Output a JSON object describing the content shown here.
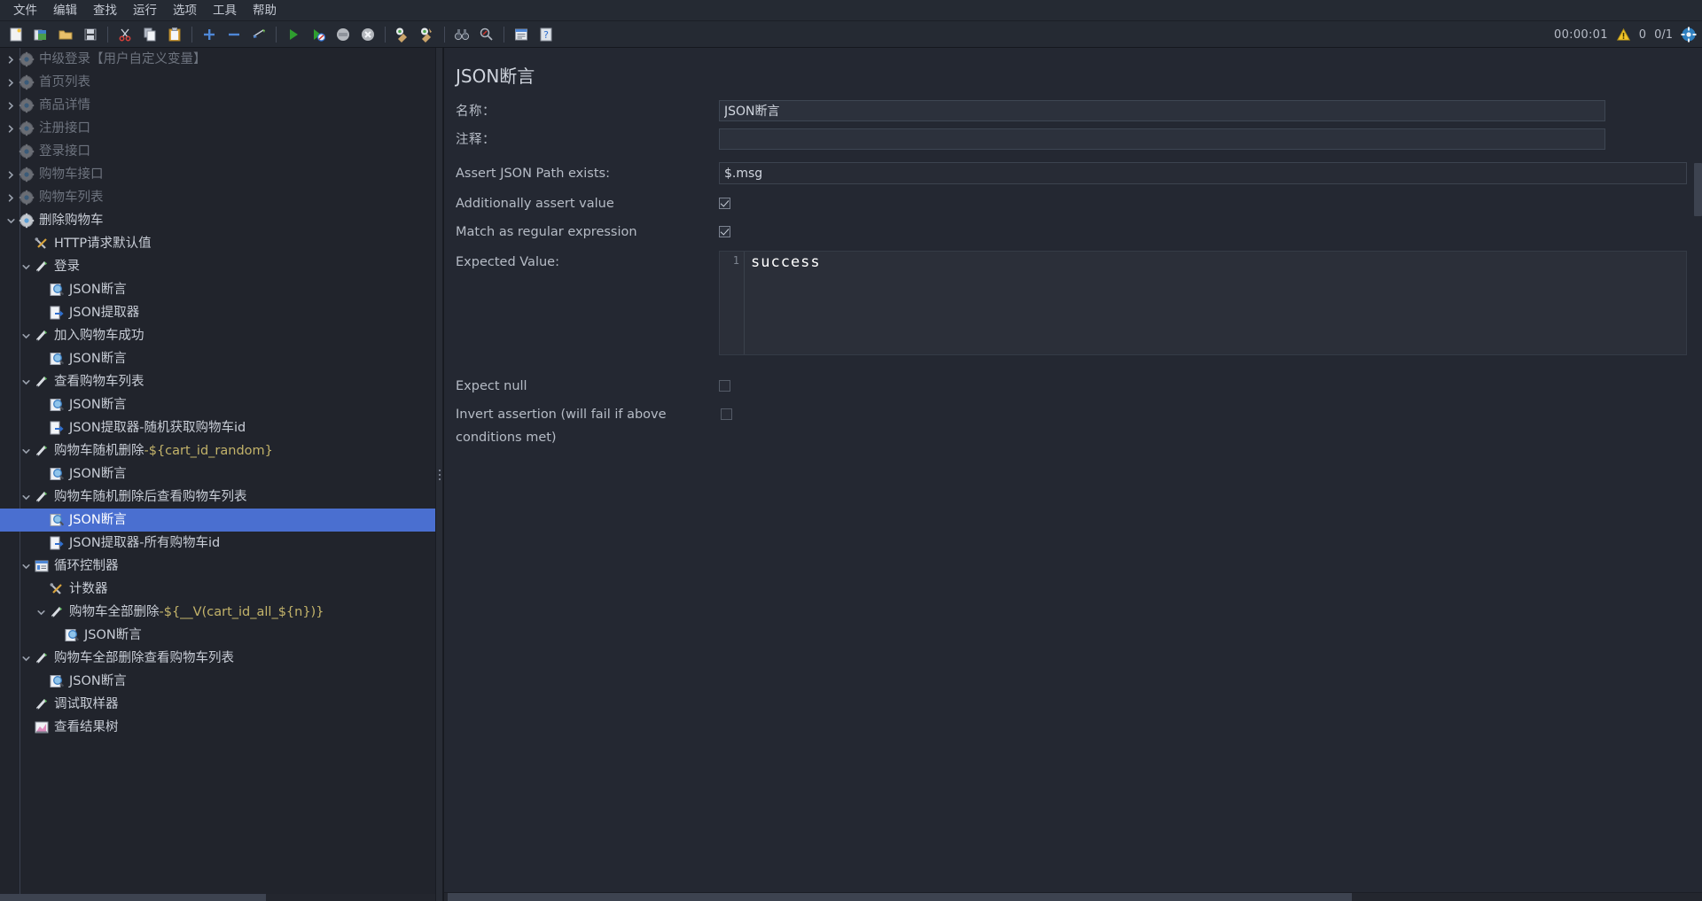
{
  "menubar": {
    "items": [
      {
        "label": "文件",
        "name": "menu-file"
      },
      {
        "label": "编辑",
        "name": "menu-edit"
      },
      {
        "label": "查找",
        "name": "menu-search"
      },
      {
        "label": "运行",
        "name": "menu-run"
      },
      {
        "label": "选项",
        "name": "menu-options"
      },
      {
        "label": "工具",
        "name": "menu-tools"
      },
      {
        "label": "帮助",
        "name": "menu-help"
      }
    ]
  },
  "toolbar": {
    "buttons": [
      {
        "icon": "new-file-icon",
        "name": "new-button"
      },
      {
        "icon": "templates-icon",
        "name": "templates-button"
      },
      {
        "icon": "open-folder-icon",
        "name": "open-button"
      },
      {
        "icon": "save-icon",
        "name": "save-button"
      },
      {
        "sep": true
      },
      {
        "icon": "cut-scissors-icon",
        "name": "cut-button"
      },
      {
        "icon": "copy-icon",
        "name": "copy-button"
      },
      {
        "icon": "paste-clipboard-icon",
        "name": "paste-button"
      },
      {
        "sep": true
      },
      {
        "icon": "expand-all-plus-icon",
        "name": "expand-all-button"
      },
      {
        "icon": "collapse-all-minus-icon",
        "name": "collapse-all-button"
      },
      {
        "icon": "toggle-pencil-icon",
        "name": "toggle-button"
      },
      {
        "sep": true
      },
      {
        "icon": "start-play-icon",
        "name": "start-button"
      },
      {
        "icon": "start-no-pauses-icon",
        "name": "start-no-pauses-button"
      },
      {
        "icon": "stop-icon",
        "name": "stop-button"
      },
      {
        "icon": "shutdown-icon",
        "name": "shutdown-button"
      },
      {
        "sep": true
      },
      {
        "icon": "clear-broom-icon",
        "name": "clear-button"
      },
      {
        "icon": "clear-all-broom-icon",
        "name": "clear-all-button"
      },
      {
        "sep": true
      },
      {
        "icon": "search-binoculars-icon",
        "name": "search-button"
      },
      {
        "icon": "search-reset-icon",
        "name": "search-reset-button"
      },
      {
        "sep": true
      },
      {
        "icon": "function-helper-icon",
        "name": "function-helper-button"
      },
      {
        "icon": "help-question-icon",
        "name": "help-button"
      }
    ],
    "status": {
      "timer": "00:00:01",
      "warning_icon": "warning-triangle-icon",
      "error_count": "0",
      "thread_count": "0/1",
      "remote_icon": "connect-remote-icon"
    }
  },
  "tree": {
    "nodes": [
      {
        "label": "中级登录【用户自定义变量】",
        "icon": "gear-icon",
        "depth": 0,
        "twisty": "right",
        "disabled": true,
        "selected": false
      },
      {
        "label": "首页列表",
        "icon": "gear-icon",
        "depth": 0,
        "twisty": "right",
        "disabled": true,
        "selected": false
      },
      {
        "label": "商品详情",
        "icon": "gear-icon",
        "depth": 0,
        "twisty": "right",
        "disabled": true,
        "selected": false
      },
      {
        "label": "注册接口",
        "icon": "gear-icon",
        "depth": 0,
        "twisty": "right",
        "disabled": true,
        "selected": false
      },
      {
        "label": "登录接口",
        "icon": "gear-icon",
        "depth": 0,
        "twisty": "none",
        "disabled": true,
        "selected": false
      },
      {
        "label": "购物车接口",
        "icon": "gear-icon",
        "depth": 0,
        "twisty": "right",
        "disabled": true,
        "selected": false
      },
      {
        "label": "购物车列表",
        "icon": "gear-icon",
        "depth": 0,
        "twisty": "right",
        "disabled": true,
        "selected": false
      },
      {
        "label": "删除购物车",
        "icon": "gear-icon",
        "depth": 0,
        "twisty": "down",
        "disabled": false,
        "selected": false
      },
      {
        "label": "HTTP请求默认值",
        "icon": "wrench-icon",
        "depth": 1,
        "twisty": "none",
        "disabled": false,
        "selected": false
      },
      {
        "label": "登录",
        "icon": "sampler-pencil-icon",
        "depth": 1,
        "twisty": "down",
        "disabled": false,
        "selected": false
      },
      {
        "label": "JSON断言",
        "icon": "assertion-magnifier-icon",
        "depth": 2,
        "twisty": "none",
        "disabled": false,
        "selected": false
      },
      {
        "label": "JSON提取器",
        "icon": "extractor-page-icon",
        "depth": 2,
        "twisty": "none",
        "disabled": false,
        "selected": false
      },
      {
        "label": "加入购物车成功",
        "icon": "sampler-pencil-icon",
        "depth": 1,
        "twisty": "down",
        "disabled": false,
        "selected": false
      },
      {
        "label": "JSON断言",
        "icon": "assertion-magnifier-icon",
        "depth": 2,
        "twisty": "none",
        "disabled": false,
        "selected": false
      },
      {
        "label": "查看购物车列表",
        "icon": "sampler-pencil-icon",
        "depth": 1,
        "twisty": "down",
        "disabled": false,
        "selected": false
      },
      {
        "label": "JSON断言",
        "icon": "assertion-magnifier-icon",
        "depth": 2,
        "twisty": "none",
        "disabled": false,
        "selected": false
      },
      {
        "label": "JSON提取器-随机获取购物车id",
        "icon": "extractor-page-icon",
        "depth": 2,
        "twisty": "none",
        "disabled": false,
        "selected": false
      },
      {
        "label": "购物车随机删除-${cart_id_random}",
        "icon": "sampler-pencil-icon",
        "depth": 1,
        "twisty": "down",
        "disabled": false,
        "selected": false,
        "var_from": 7
      },
      {
        "label": "JSON断言",
        "icon": "assertion-magnifier-icon",
        "depth": 2,
        "twisty": "none",
        "disabled": false,
        "selected": false
      },
      {
        "label": "购物车随机删除后查看购物车列表",
        "icon": "sampler-pencil-icon",
        "depth": 1,
        "twisty": "down",
        "disabled": false,
        "selected": false
      },
      {
        "label": "JSON断言",
        "icon": "assertion-magnifier-icon",
        "depth": 2,
        "twisty": "none",
        "disabled": false,
        "selected": true
      },
      {
        "label": "JSON提取器-所有购物车id",
        "icon": "extractor-page-icon",
        "depth": 2,
        "twisty": "none",
        "disabled": false,
        "selected": false
      },
      {
        "label": "循环控制器",
        "icon": "loop-controller-icon",
        "depth": 1,
        "twisty": "down",
        "disabled": false,
        "selected": false
      },
      {
        "label": "计数器",
        "icon": "wrench-icon",
        "depth": 2,
        "twisty": "none",
        "disabled": false,
        "selected": false
      },
      {
        "label": "购物车全部删除-${__V(cart_id_all_${n})}",
        "icon": "sampler-pencil-icon",
        "depth": 2,
        "twisty": "down",
        "disabled": false,
        "selected": false,
        "var_from": 7
      },
      {
        "label": "JSON断言",
        "icon": "assertion-magnifier-icon",
        "depth": 3,
        "twisty": "none",
        "disabled": false,
        "selected": false
      },
      {
        "label": "购物车全部删除查看购物车列表",
        "icon": "sampler-pencil-icon",
        "depth": 1,
        "twisty": "down",
        "disabled": false,
        "selected": false
      },
      {
        "label": "JSON断言",
        "icon": "assertion-magnifier-icon",
        "depth": 2,
        "twisty": "none",
        "disabled": false,
        "selected": false
      },
      {
        "label": "调试取样器",
        "icon": "sampler-pencil-icon",
        "depth": 1,
        "twisty": "none",
        "disabled": false,
        "selected": false
      },
      {
        "label": "查看结果树",
        "icon": "results-tree-icon",
        "depth": 1,
        "twisty": "none",
        "disabled": false,
        "selected": false
      }
    ]
  },
  "panel": {
    "title": "JSON断言",
    "name_label": "名称：",
    "name_value": "JSON断言",
    "comment_label": "注释：",
    "comment_value": "",
    "jsonpath_label": "Assert JSON Path exists:",
    "jsonpath_value": "$.msg",
    "additionally_assert_label": "Additionally assert value",
    "additionally_assert_checked": true,
    "regex_label": "Match as regular expression",
    "regex_checked": true,
    "expected_label": "Expected Value:",
    "expected_line_number": "1",
    "expected_value": "success",
    "expect_null_label": "Expect null",
    "expect_null_checked": false,
    "invert_label": "Invert assertion (will fail if above conditions met)",
    "invert_checked": false
  },
  "colors": {
    "selection": "#4a6fd0",
    "window_bg": "#20232b",
    "panel_bg": "#242832",
    "text": "#c8cdd6",
    "text_disabled": "#6e747f",
    "variable_text": "#c3b36a",
    "accent_green": "#53b34a"
  }
}
